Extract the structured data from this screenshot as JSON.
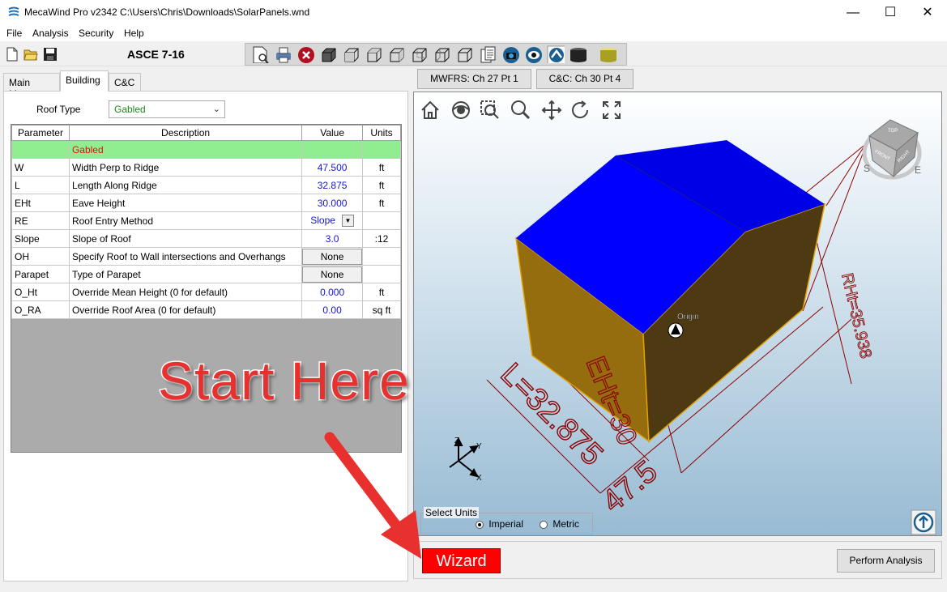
{
  "window": {
    "title": "MecaWind Pro v2342 C:\\Users\\Chris\\Downloads\\SolarPanels.wnd",
    "minimize": "—",
    "maximize": "☐",
    "close": "✕"
  },
  "menu": [
    "File",
    "Analysis",
    "Security",
    "Help"
  ],
  "toolbar": {
    "code": "ASCE 7-16",
    "tools": [
      "new-file-icon",
      "open-folder-icon",
      "save-icon",
      "print-preview-icon",
      "print-icon",
      "stop-icon",
      "cube-solid-icon",
      "cube-wire-1-icon",
      "cube-wire-2-icon",
      "cube-wire-3-icon",
      "cube-wire-4-icon",
      "cube-wire-5-icon",
      "cube-wire-6-icon",
      "report-icon",
      "camera-icon",
      "eye-icon",
      "rotate-view-icon",
      "cylinder-dark-icon",
      "cylinder-yellow-icon"
    ]
  },
  "tabs": [
    "Main Menu",
    "Building",
    "C&C"
  ],
  "roof_type": {
    "label": "Roof Type",
    "value": "Gabled"
  },
  "grid": {
    "headers": [
      "Parameter",
      "Description",
      "Value",
      "Units"
    ],
    "rows": [
      {
        "param": "",
        "desc": "Gabled",
        "value": "",
        "unit": ""
      },
      {
        "param": "W",
        "desc": "Width Perp to Ridge",
        "value": "47.500",
        "unit": "ft"
      },
      {
        "param": "L",
        "desc": "Length Along Ridge",
        "value": "32.875",
        "unit": "ft"
      },
      {
        "param": "EHt",
        "desc": "Eave Height",
        "value": "30.000",
        "unit": "ft"
      },
      {
        "param": "RE",
        "desc": "Roof Entry Method",
        "value": "Slope",
        "unit": ""
      },
      {
        "param": "Slope",
        "desc": "Slope of Roof",
        "value": "3.0",
        "unit": ":12"
      },
      {
        "param": "OH",
        "desc": "Specify Roof to Wall intersections and Overhangs",
        "value": "None",
        "unit": ""
      },
      {
        "param": "Parapet",
        "desc": "Type of Parapet",
        "value": "None",
        "unit": ""
      },
      {
        "param": "O_Ht",
        "desc": "Override Mean Height (0 for default)",
        "value": "0.000",
        "unit": "ft"
      },
      {
        "param": "O_RA",
        "desc": "Override Roof Area (0 for default)",
        "value": "0.00",
        "unit": "sq ft"
      }
    ]
  },
  "view_tabs": [
    "MWFRS: Ch 27 Pt 1",
    "C&C: Ch 30 Pt 4"
  ],
  "viewport": {
    "nav_icons": [
      "home-icon",
      "eye-icon",
      "zoom-window-icon",
      "zoom-icon",
      "pan-icon",
      "rotate-icon",
      "fit-icon"
    ],
    "dims": {
      "L": "L=32.875",
      "W": "47.5",
      "EHt": "EHt=30",
      "RHt": "RHt=35.938"
    },
    "origin": "Origin",
    "viewcube": {
      "top": "TOP",
      "front": "FRONT",
      "right": "RIGHT",
      "s": "S",
      "e": "E"
    },
    "axes": {
      "x": "X",
      "y": "Y",
      "z": "Z"
    },
    "colors": {
      "roof": "#0000ff",
      "wall_light": "#956d0e",
      "wall_dark": "#4d3a12",
      "dims": "#8b0000"
    }
  },
  "units": {
    "legend": "Select Units",
    "options": [
      "Imperial",
      "Metric"
    ],
    "selected": "Imperial"
  },
  "buttons": {
    "wizard": "Wizard",
    "perform": "Perform Analysis"
  },
  "annotation": "Start Here"
}
